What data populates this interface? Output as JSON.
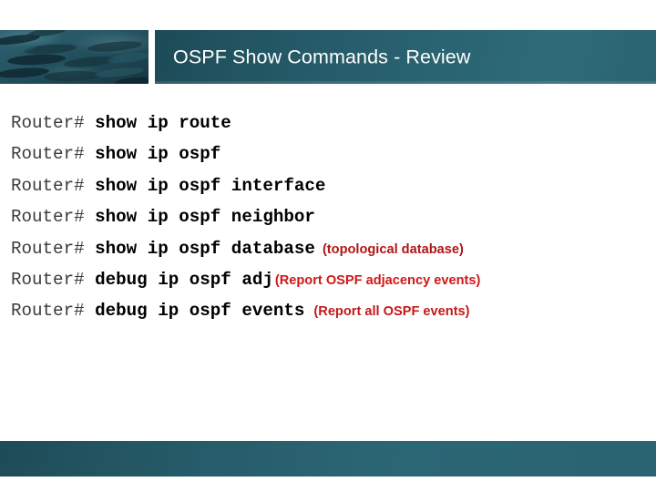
{
  "slide": {
    "title": "OSPF Show Commands - Review",
    "background_color": "#ffffff",
    "banner_color": "#2a6472",
    "footer_color": "#2a6371"
  },
  "header": {
    "photo_alt": "underwater-fish-school-photo"
  },
  "commands": [
    {
      "prompt": "Router# ",
      "command": "show ip route",
      "note": ""
    },
    {
      "prompt": "Router# ",
      "command": "show ip ospf",
      "note": ""
    },
    {
      "prompt": "Router# ",
      "command": "show ip ospf interface",
      "note": ""
    },
    {
      "prompt": "Router# ",
      "command": "show ip ospf neighbor",
      "note": ""
    },
    {
      "prompt": "Router# ",
      "command": "show ip ospf database",
      "note": "(topological database)"
    },
    {
      "prompt": "Router# ",
      "command": "debug ip ospf adj",
      "note": "(Report OSPF adjacency events)"
    },
    {
      "prompt": "Router# ",
      "command": "debug ip ospf events",
      "note": "(Report all OSPF events)"
    }
  ],
  "note_colors": {
    "topological_database": "#b01616",
    "adjacency_events": "#d01717",
    "all_events": "#c41818"
  }
}
